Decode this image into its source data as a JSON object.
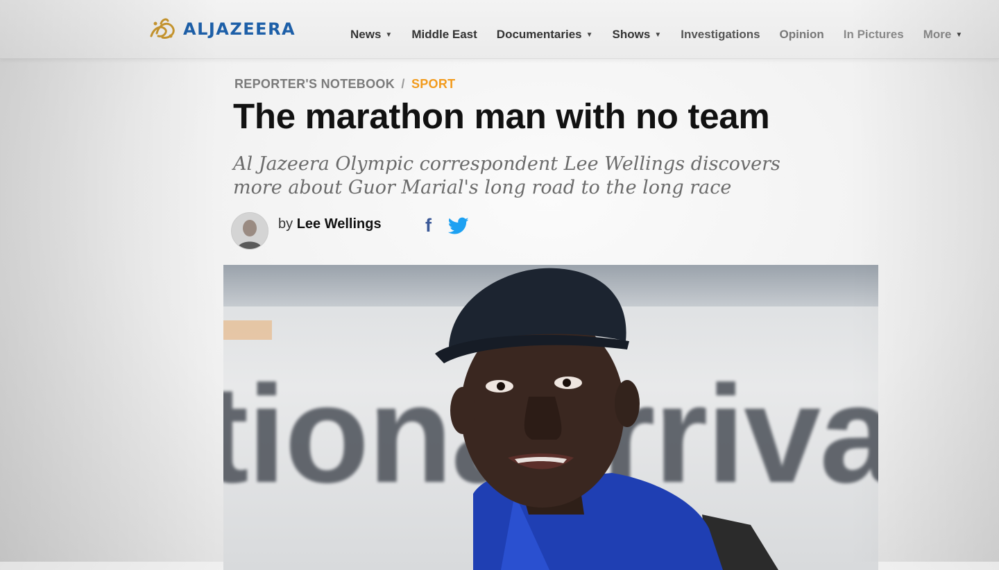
{
  "site": {
    "logo_text": "ALJAZEERA",
    "brand_color": "#1d5fa8"
  },
  "nav": {
    "items": [
      {
        "label": "News",
        "dropdown": true
      },
      {
        "label": "Middle East",
        "dropdown": false
      },
      {
        "label": "Documentaries",
        "dropdown": true
      },
      {
        "label": "Shows",
        "dropdown": true
      },
      {
        "label": "Investigations",
        "dropdown": false
      },
      {
        "label": "Opinion",
        "dropdown": false
      },
      {
        "label": "In Pictures",
        "dropdown": false
      },
      {
        "label": "More",
        "dropdown": true
      }
    ]
  },
  "article": {
    "section": "REPORTER'S NOTEBOOK",
    "separator": "/",
    "category": "SPORT",
    "category_color": "#f29b1d",
    "headline": "The marathon man with no team",
    "standfirst": "Al Jazeera Olympic correspondent Lee Wellings discovers more about Guor Marial's long road to the long race",
    "byline_prefix": "by",
    "author": "Lee Wellings"
  },
  "share": {
    "facebook_glyph": "f",
    "facebook_color": "#3b5998",
    "twitter_color": "#1da1f2"
  },
  "hero": {
    "sign_text": "tional  rriva"
  }
}
